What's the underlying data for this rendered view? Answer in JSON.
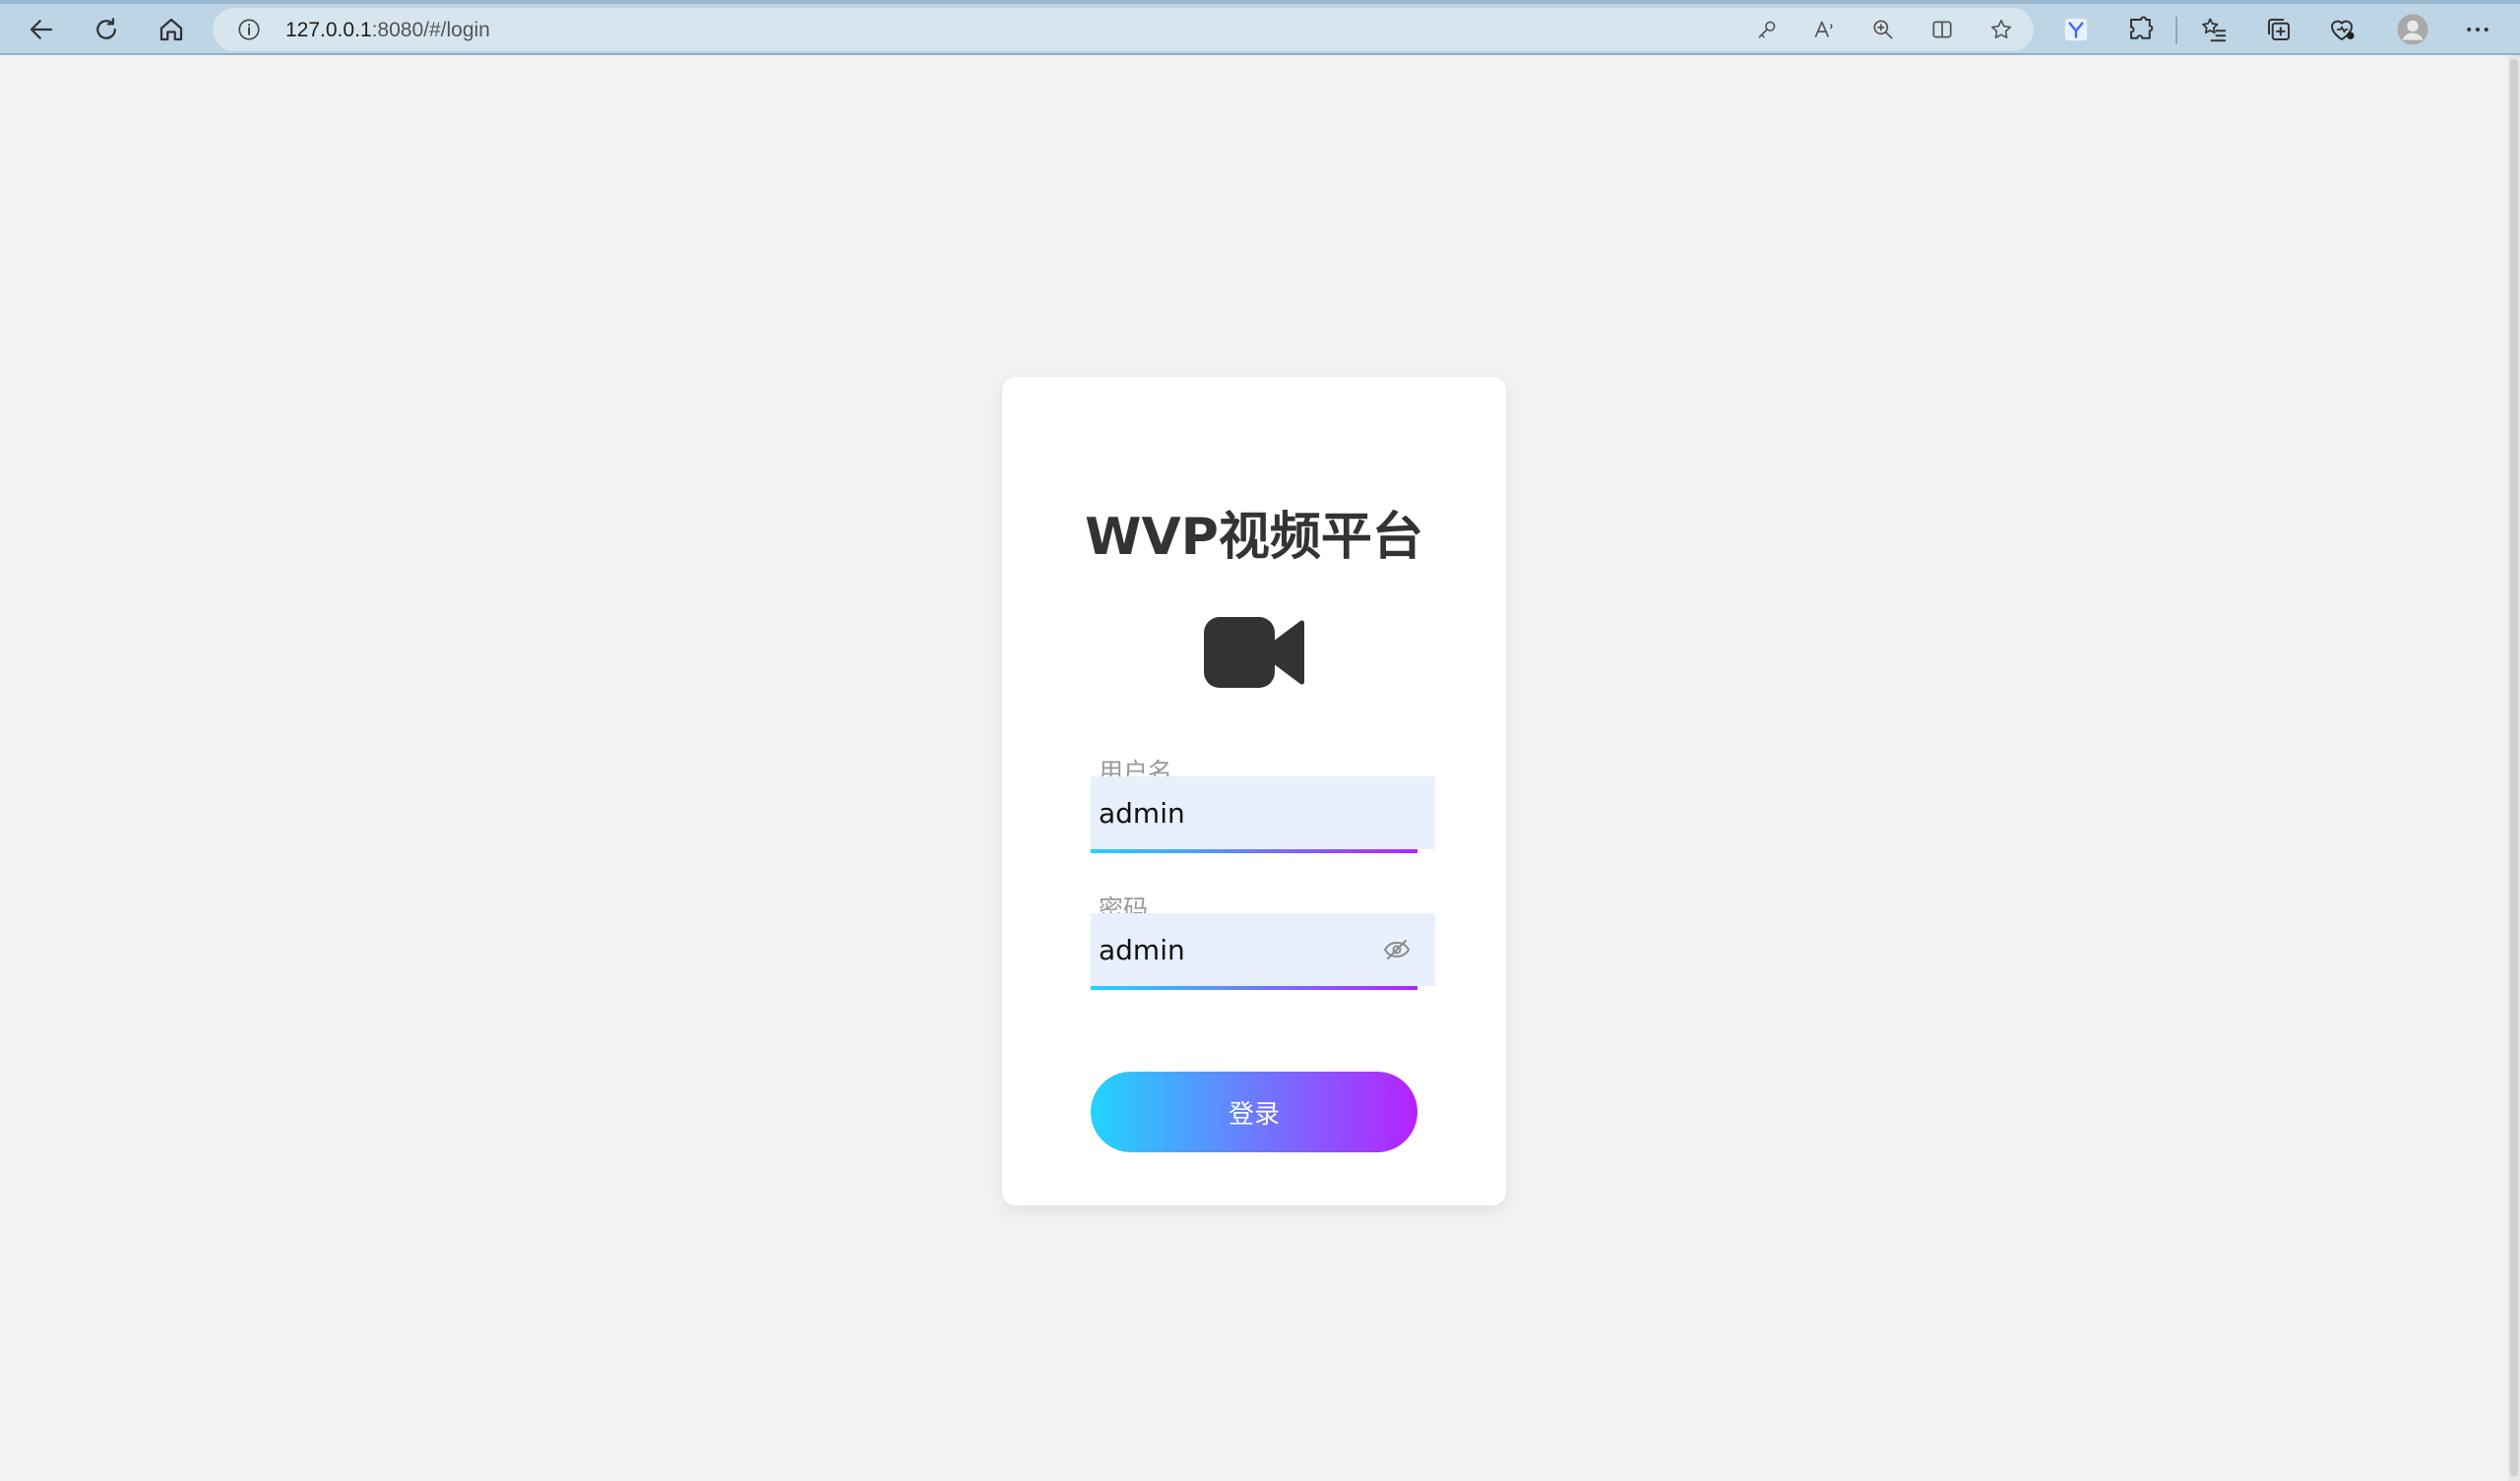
{
  "browser": {
    "url_host": "127.0.0.1",
    "url_rest": ":8080/#/login",
    "icons": [
      "back-icon",
      "refresh-icon",
      "home-icon",
      "site-info-icon",
      "password-key-icon",
      "read-aloud-icon",
      "zoom-icon",
      "split-screen-icon",
      "favorite-star-icon",
      "extension-app-icon",
      "extensions-puzzle-icon",
      "favorites-icon",
      "collections-icon",
      "browser-essentials-icon",
      "profile-avatar-icon",
      "more-menu-icon"
    ]
  },
  "login": {
    "title": "WVP视频平台",
    "username_label": "用户名",
    "username_value": "admin",
    "password_label": "密码",
    "password_value": "admin",
    "submit_label": "登录"
  },
  "colors": {
    "gradient_start": "#21d4fd",
    "gradient_end": "#b721ff",
    "page_bg": "#f2f2f2",
    "input_bg": "#e8f0fe"
  }
}
